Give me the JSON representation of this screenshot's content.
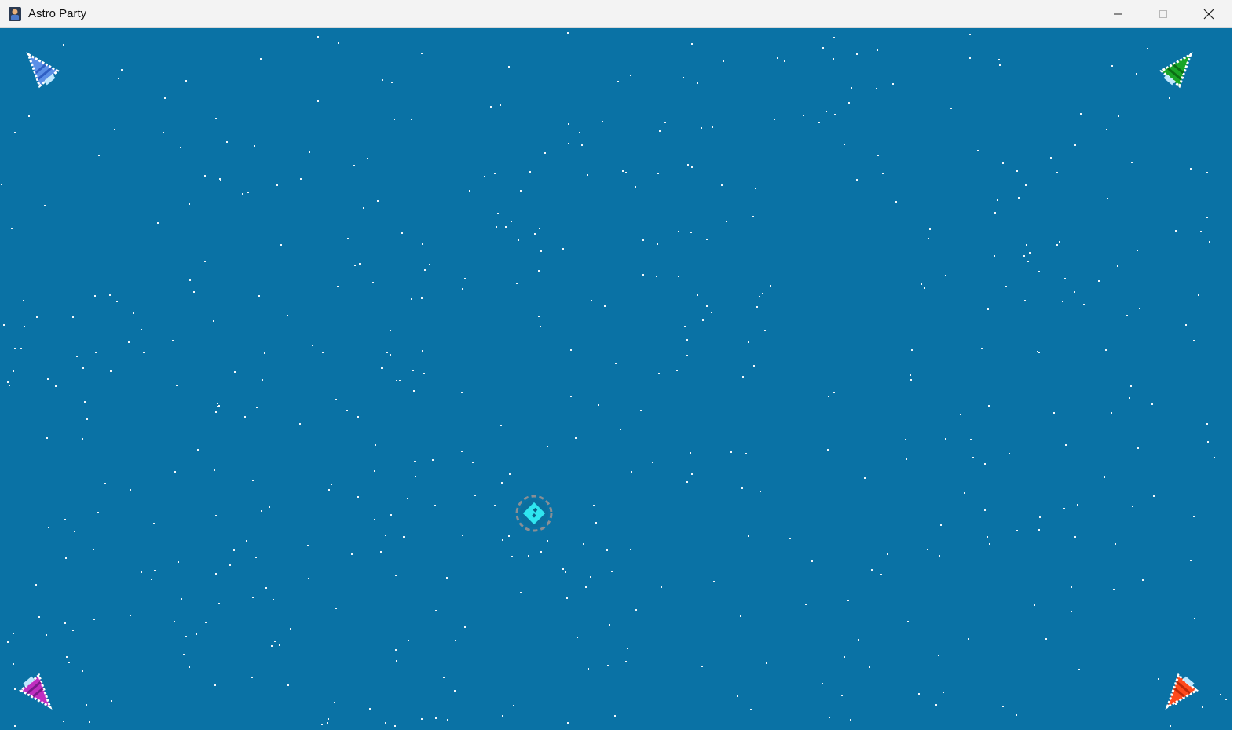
{
  "window": {
    "title": "Astro Party",
    "controls": [
      "minimize-icon",
      "maximize-icon",
      "close-icon"
    ]
  },
  "game": {
    "background_color": "#0a72a5",
    "star_color": "#f4f8fb",
    "players": [
      {
        "name": "player-ship-blue",
        "color": "#5b8fe6",
        "stripe": "#2f5fc4",
        "corner": "top-left"
      },
      {
        "name": "player-ship-green",
        "color": "#1aa526",
        "stripe": "#0b6e14",
        "corner": "top-right"
      },
      {
        "name": "player-ship-purple",
        "color": "#c02ec0",
        "stripe": "#7a1b8a",
        "corner": "bottom-left"
      },
      {
        "name": "player-ship-red",
        "color": "#ff4a1c",
        "stripe": "#c02a0a",
        "corner": "bottom-right"
      }
    ],
    "powerup": {
      "name": "shield-powerup",
      "core_color": "#2fe6f0",
      "ring_color": "#8a8f94"
    }
  }
}
